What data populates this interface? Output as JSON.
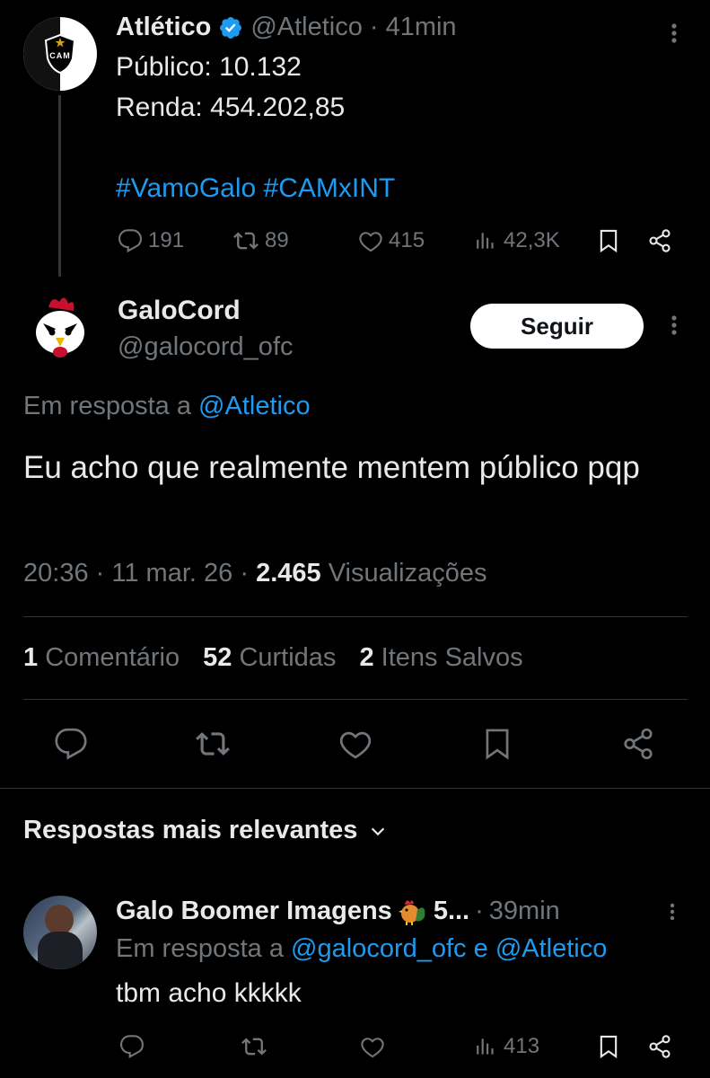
{
  "parent_tweet": {
    "name": "Atlético",
    "handle": "@Atletico",
    "time": "41min",
    "line1": "Público: 10.132",
    "line2": "Renda: 454.202,85",
    "hashtags": "#VamoGalo #CAMxINT",
    "replies": "191",
    "retweets": "89",
    "likes": "415",
    "views": "42,3K",
    "avatar_text": "CAM"
  },
  "main_tweet": {
    "name": "GaloCord",
    "handle": "@galocord_ofc",
    "follow_label": "Seguir",
    "reply_prefix": "Em resposta a",
    "reply_to": "@Atletico",
    "text": "Eu acho que realmente mentem público pqp",
    "time": "20:36",
    "date": "11 mar. 26",
    "views_count": "2.465",
    "views_label": "Visualizações",
    "stats": {
      "comments_count": "1",
      "comments_label": "Comentário",
      "likes_count": "52",
      "likes_label": "Curtidas",
      "saves_count": "2",
      "saves_label": "Itens Salvos"
    }
  },
  "replies_header": "Respostas mais relevantes",
  "reply": {
    "name": "Galo Boomer Imagens",
    "name_suffix": "5...",
    "time": "39min",
    "reply_prefix": "Em resposta a",
    "mention1": "@galocord_ofc",
    "conj": "e",
    "mention2": "@Atletico",
    "text": "tbm acho kkkkk",
    "views": "413"
  },
  "colors": {
    "background": "#000000",
    "text": "#e7e9ea",
    "muted": "#71767b",
    "link": "#1d9bf0",
    "divider": "#2f3336",
    "verified": "#1d9bf0"
  }
}
